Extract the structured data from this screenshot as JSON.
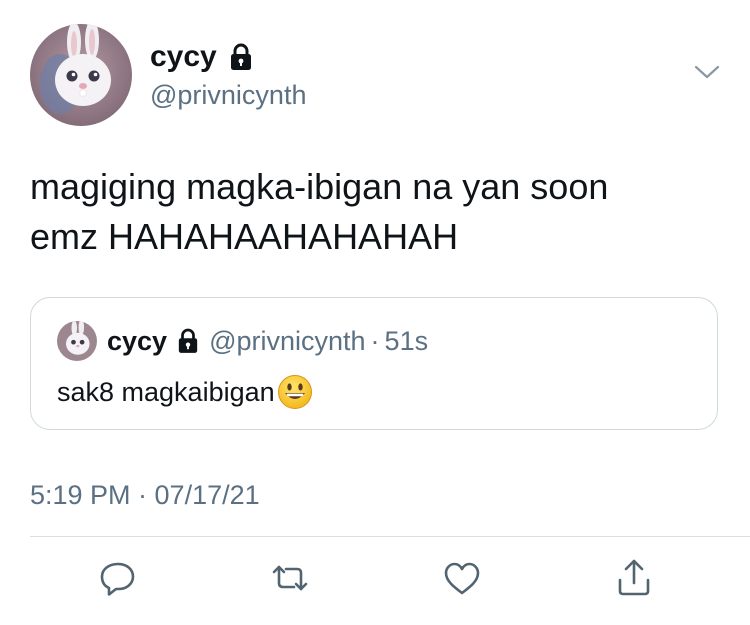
{
  "tweet": {
    "author": {
      "display_name": "cycy",
      "handle": "@privnicynth",
      "protected_icon": "lock-icon",
      "avatar": "white-bunny-avatar"
    },
    "menu_icon": "chevron-down-icon",
    "text": "magiging magka-ibigan na yan soon\nemz HAHAHAAHAHAHAH",
    "quoted_tweet": {
      "author_display_name": "cycy",
      "author_handle": "@privnicynth",
      "separator": "·",
      "relative_time": "51s",
      "text": "sak8 magkaibigan",
      "emoji": "grinning-face-emoji"
    },
    "timestamp": "5:19 PM · 07/17/21"
  },
  "actions": [
    {
      "icon": "reply-icon"
    },
    {
      "icon": "retweet-icon"
    },
    {
      "icon": "like-icon"
    },
    {
      "icon": "share-icon"
    }
  ],
  "colors": {
    "text_primary": "#0f1419",
    "text_secondary": "#5b7083",
    "border": "#cfd9de",
    "icon": "#536471"
  }
}
